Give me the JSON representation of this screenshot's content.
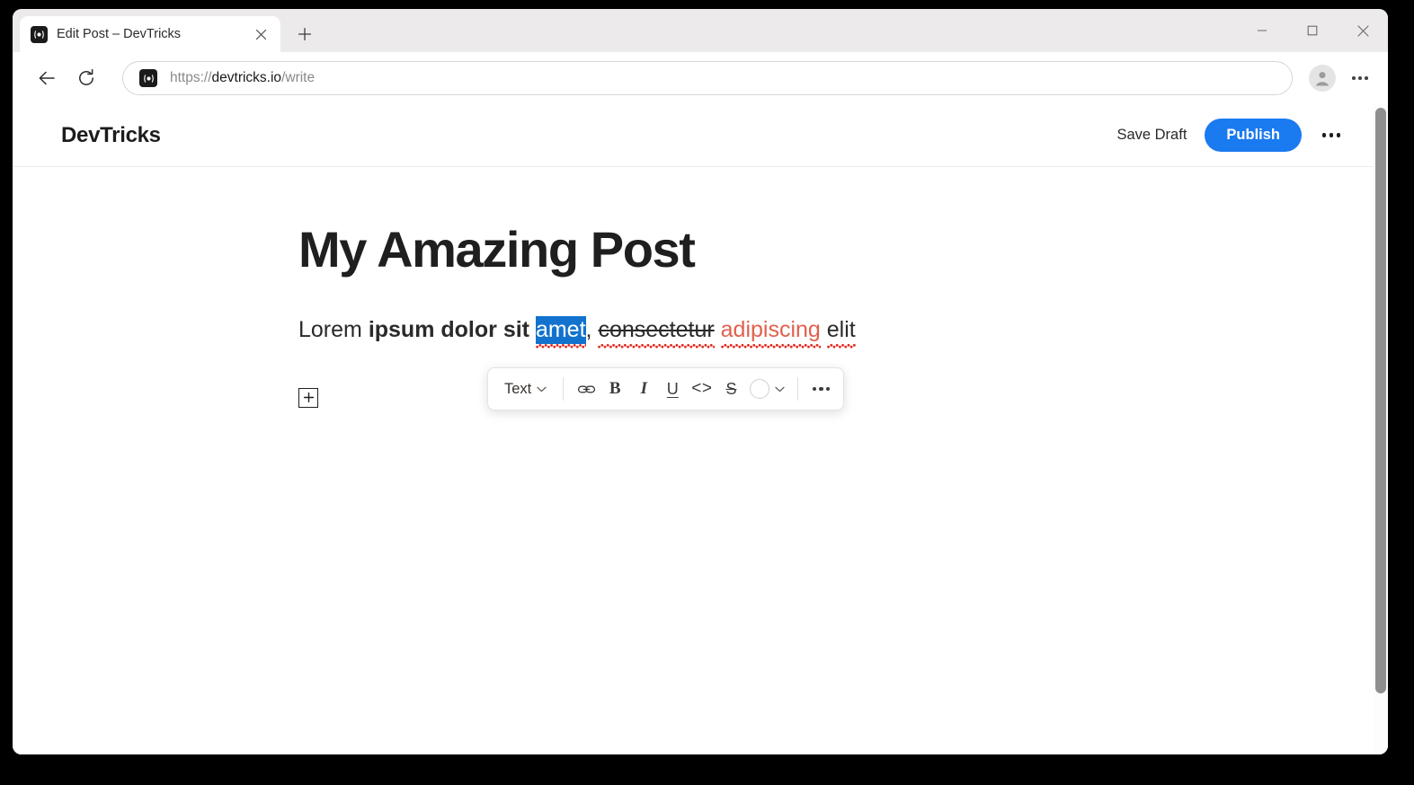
{
  "browser": {
    "tab": {
      "title": "Edit Post – DevTricks",
      "favicon_name": "devtricks-favicon",
      "close_label": "×",
      "new_tab_label": "+"
    },
    "window_controls": {
      "minimize": "minimize-icon",
      "maximize": "maximize-icon",
      "close": "close-icon"
    },
    "nav": {
      "back": "back-arrow-icon",
      "reload": "reload-icon",
      "url_scheme": "https://",
      "url_host": "devtricks.io",
      "url_path": "/write",
      "url_full": "https://devtricks.io/write",
      "profile": "profile-avatar",
      "menu": "browser-menu-icon"
    }
  },
  "app": {
    "brand": "DevTricks",
    "header": {
      "save_draft_label": "Save Draft",
      "publish_label": "Publish",
      "overflow_label": "•••"
    },
    "accent_color": "#1a7af0"
  },
  "editor": {
    "title": "My Amazing Post",
    "add_block_label": "+",
    "paragraph": {
      "segments": [
        {
          "text": "Lorem ",
          "style": "plain"
        },
        {
          "text": "ipsum dolor sit ",
          "style": "bold"
        },
        {
          "text": "amet",
          "style": "selected-misspelled"
        },
        {
          "text": ", ",
          "style": "plain"
        },
        {
          "text": "consectetur",
          "style": "strikethrough-misspelled"
        },
        {
          "text": " ",
          "style": "plain"
        },
        {
          "text": "adipiscing",
          "style": "colored-misspelled"
        },
        {
          "text": " ",
          "style": "plain"
        },
        {
          "text": "elit",
          "style": "misspelled"
        }
      ],
      "plain_text": "Lorem ipsum dolor sit amet, consectetur adipiscing elit",
      "selection_color": "#1273ce",
      "text_color_applied": "#e0614d",
      "spellcheck_color": "#e02b20"
    }
  },
  "format_toolbar": {
    "block_type_label": "Text",
    "block_type_caret": "chevron-down",
    "items": [
      {
        "name": "link",
        "glyph": "link-icon"
      },
      {
        "name": "bold",
        "glyph": "B"
      },
      {
        "name": "italic",
        "glyph": "I"
      },
      {
        "name": "underline",
        "glyph": "U"
      },
      {
        "name": "code",
        "glyph": "<>"
      },
      {
        "name": "strikethrough",
        "glyph": "S"
      },
      {
        "name": "text-color",
        "glyph": "color-swatch"
      },
      {
        "name": "more",
        "glyph": "•••"
      }
    ],
    "bold_glyph": "B",
    "italic_glyph": "I",
    "underline_glyph": "U",
    "code_glyph": "<>",
    "strike_glyph": "S",
    "more_glyph": "•••"
  }
}
